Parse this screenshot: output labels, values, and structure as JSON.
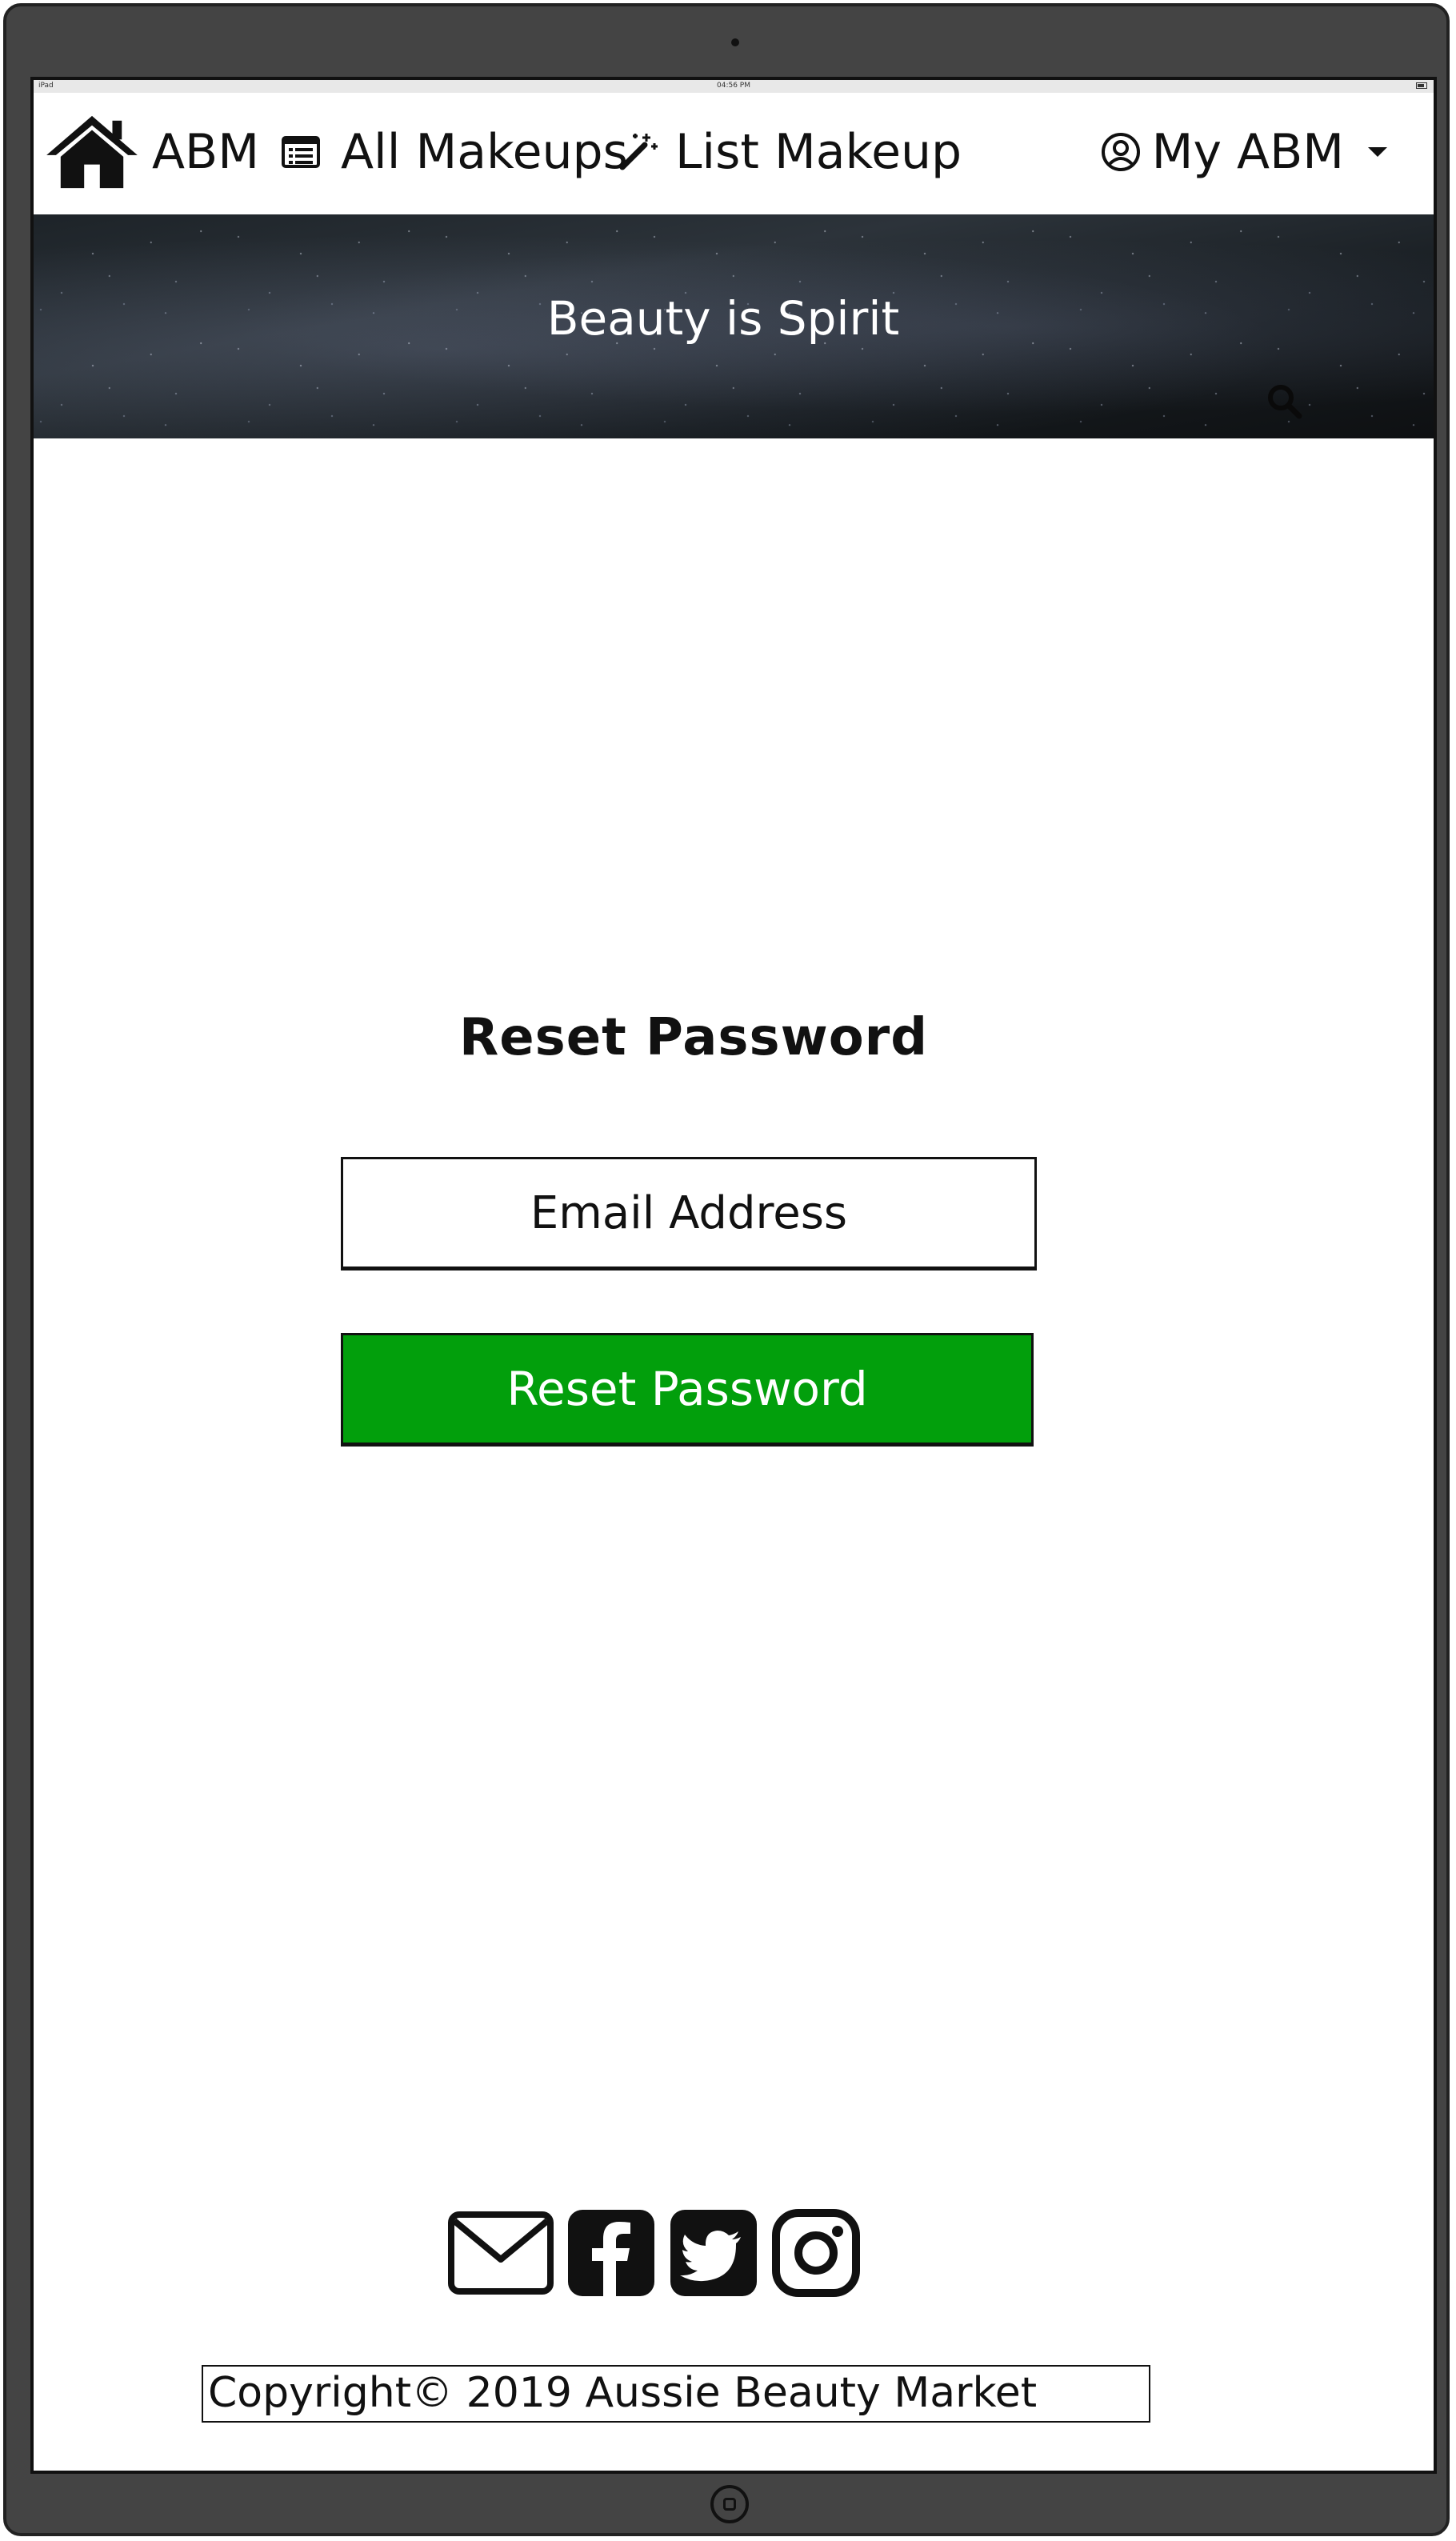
{
  "status_bar": {
    "device": "iPad",
    "time": "04:56 PM"
  },
  "nav": {
    "brand": "ABM",
    "all_makeups": "All Makeups",
    "list_makeup": "List Makeup",
    "account": "My ABM"
  },
  "banner": {
    "tagline": "Beauty is Spirit"
  },
  "reset_form": {
    "title": "Reset Password",
    "email_placeholder": "Email Address",
    "submit_label": "Reset Password"
  },
  "footer": {
    "social_icons": [
      "envelope-icon",
      "facebook-icon",
      "twitter-icon",
      "instagram-icon"
    ],
    "copyright": "Copyright© 2019 Aussie Beauty Market"
  },
  "colors": {
    "primary_button": "#029f0c",
    "device_frame": "#444444"
  }
}
